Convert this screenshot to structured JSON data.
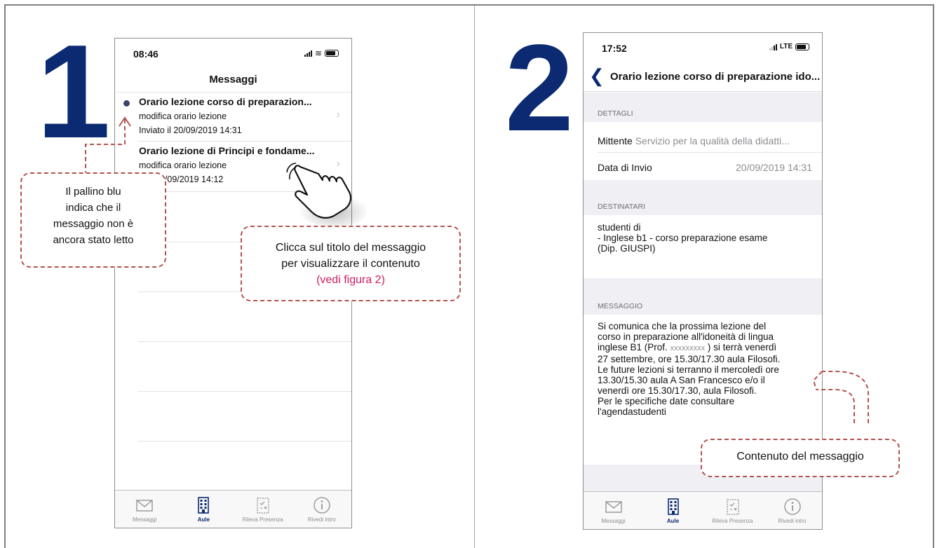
{
  "step1": {
    "number": "1"
  },
  "step2": {
    "number": "2"
  },
  "phone1": {
    "time": "08:46",
    "nav_title": "Messaggi",
    "messages": [
      {
        "title": "Orario lezione corso di preparazion...",
        "subtitle": "modifica orario lezione",
        "sent": "Inviato il 20/09/2019 14:31",
        "unread": true
      },
      {
        "title": "Orario lezione di Principi e fondame...",
        "subtitle": "modifica orario lezione",
        "sent": "il 20/09/2019 14:12",
        "unread": false
      }
    ]
  },
  "tabs": [
    {
      "label": "Messaggi",
      "icon": "envelope-icon",
      "active": false
    },
    {
      "label": "Aule",
      "icon": "building-icon",
      "active": true
    },
    {
      "label": "Rileva Presenza",
      "icon": "clipboard-check-icon",
      "active": false
    },
    {
      "label": "Rivedi intro",
      "icon": "info-icon",
      "active": false
    }
  ],
  "callouts": {
    "unread_lines": [
      "Il pallino blu",
      "indica che il",
      "messaggio non è",
      "ancora stato letto"
    ],
    "click_line1": "Clicca sul titolo del messaggio",
    "click_line2": "per visualizzare il contenuto",
    "click_link": "(vedi figura 2)",
    "content": "Contenuto del messaggio"
  },
  "phone2": {
    "time": "17:52",
    "network": "LTE",
    "title": "Orario lezione corso di preparazione ido...",
    "dettagli_header": "DETTAGLI",
    "mittente_label": "Mittente",
    "mittente_value": "Servizio per la qualità della didatti...",
    "data_label": "Data di Invio",
    "data_value": "20/09/2019 14:31",
    "destinatari_header": "DESTINATARI",
    "destinatari_lines": [
      "studenti di",
      "- Inglese b1 - corso preparazione esame",
      "(Dip. GIUSPI)"
    ],
    "messaggio_header": "MESSAGGIO",
    "message_line1": "Si comunica che la prossima lezione del",
    "message_line2": "corso in preparazione all'idoneità di lingua",
    "message_line3a": "inglese B1 (Prof.",
    "message_masked": "xxxxxxxxx",
    "message_line3b": ") si terrà venerdì",
    "message_rest": [
      "27 settembre, ore 15.30/17.30 aula Filosofi.",
      "Le future lezioni si terranno il mercoledì ore",
      "13.30/15.30 aula A San Francesco e/o il",
      "venerdì ore 15.30/17.30, aula Filosofi.",
      "Per le specifiche date consultare",
      "l'agendastudenti"
    ]
  }
}
